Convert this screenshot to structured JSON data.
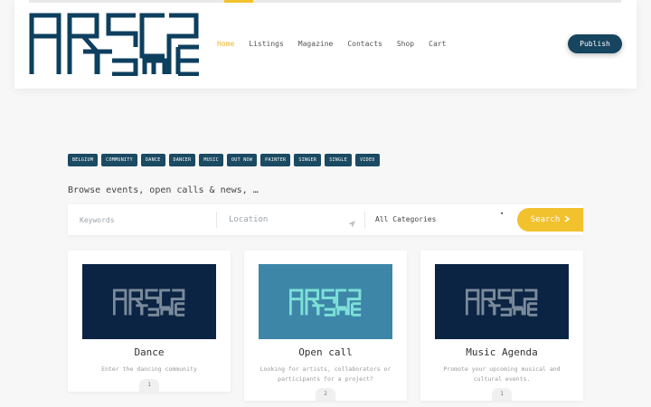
{
  "header": {
    "logo_text": "ARTSCAPE",
    "nav": [
      {
        "label": "Home",
        "active": true
      },
      {
        "label": "Listings",
        "active": false
      },
      {
        "label": "Magazine",
        "active": false
      },
      {
        "label": "Contacts",
        "active": false
      },
      {
        "label": "Shop",
        "active": false
      },
      {
        "label": "Cart",
        "active": false
      }
    ],
    "publish_label": "Publish"
  },
  "tags": [
    "BELGIUM",
    "COMMUNITY",
    "DANCE",
    "DANCER",
    "MUSIC",
    "OUT NOW",
    "PAINTER",
    "SINGER",
    "SINGLE",
    "VIDEO"
  ],
  "browse_text": "Browse events, open calls & news, …",
  "search": {
    "keywords_placeholder": "Keywords",
    "location_placeholder": "Location",
    "category_selected": "All Categories",
    "button_label": "Search"
  },
  "cards": [
    {
      "title": "Dance",
      "description": "Enter the dancing community",
      "count": "1",
      "image_bg": "#0b2443",
      "logo_color": "#7a8a9a"
    },
    {
      "title": "Open call",
      "description": "Looking for artists, collaborators or participants for a project?",
      "count": "2",
      "image_bg": "#3d86a8",
      "logo_color": "#7de0d8"
    },
    {
      "title": "Music Agenda",
      "description": "Promote your upcoming musical and cultural events.",
      "count": "1",
      "image_bg": "#0b2443",
      "logo_color": "#7a8a9a"
    }
  ],
  "colors": {
    "accent": "#f2c12e",
    "brand": "#17445f",
    "tag_bg": "#1b4a63"
  }
}
